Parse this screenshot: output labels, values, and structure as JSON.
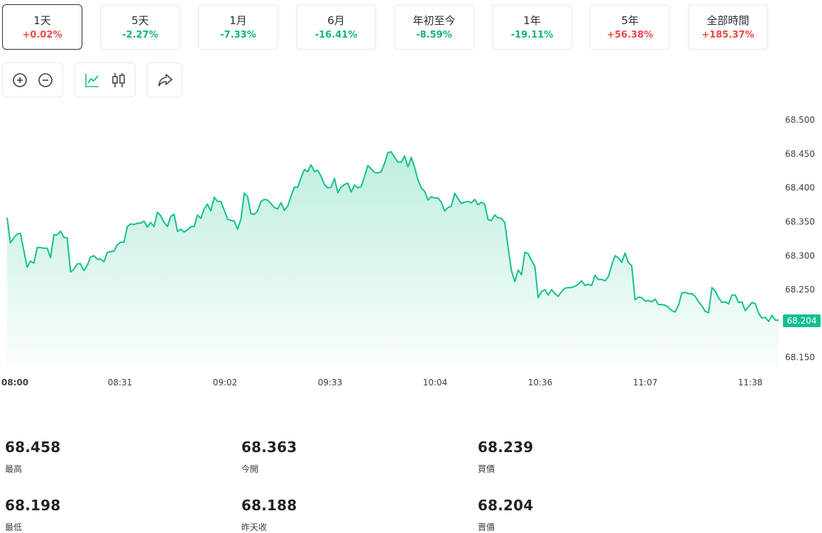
{
  "ranges": [
    {
      "label": "1天",
      "change": "+0.02%",
      "direction": "up",
      "active": true
    },
    {
      "label": "5天",
      "change": "-2.27%",
      "direction": "down",
      "active": false
    },
    {
      "label": "1月",
      "change": "-7.33%",
      "direction": "down",
      "active": false
    },
    {
      "label": "6月",
      "change": "-16.41%",
      "direction": "down",
      "active": false
    },
    {
      "label": "年初至今",
      "change": "-8.59%",
      "direction": "down",
      "active": false
    },
    {
      "label": "1年",
      "change": "-19.11%",
      "direction": "down",
      "active": false
    },
    {
      "label": "5年",
      "change": "+56.38%",
      "direction": "up",
      "active": false
    },
    {
      "label": "全部時間",
      "change": "+185.37%",
      "direction": "up",
      "active": false
    }
  ],
  "toolbar": {
    "zoom_in_icon": "zoom-in-icon",
    "zoom_out_icon": "zoom-out-icon",
    "line_chart_icon": "line-chart-icon",
    "candlestick_icon": "candlestick-icon",
    "share_icon": "share-icon",
    "active_chart_type": "line"
  },
  "colors": {
    "line": "#14c08f",
    "up": "#f04848",
    "down": "#14b37d",
    "price_tag": "#14c08f"
  },
  "chart_data": {
    "type": "area",
    "title": "",
    "xlabel": "",
    "ylabel": "",
    "ylim": [
      68.135,
      68.52
    ],
    "y_ticks": [
      "68.150",
      "68.200",
      "68.250",
      "68.300",
      "68.350",
      "68.400",
      "68.450",
      "68.500"
    ],
    "x_ticks": [
      "08:00",
      "08:31",
      "09:02",
      "09:33",
      "10:04",
      "10:36",
      "11:07",
      "11:38"
    ],
    "current_price": "68.204",
    "grid": false,
    "legend": "none",
    "series": [
      {
        "values": [
          68.356,
          68.319,
          68.326,
          68.332,
          68.333,
          68.308,
          68.283,
          68.292,
          68.289,
          68.312,
          68.312,
          68.311,
          68.311,
          68.297,
          68.331,
          68.331,
          68.336,
          68.327,
          68.326,
          68.276,
          68.28,
          68.288,
          68.288,
          68.278,
          68.286,
          68.298,
          68.3,
          68.295,
          68.295,
          68.291,
          68.305,
          68.306,
          68.307,
          68.316,
          68.32,
          68.32,
          68.343,
          68.347,
          68.346,
          68.348,
          68.348,
          68.351,
          68.342,
          68.349,
          68.343,
          68.364,
          68.359,
          68.349,
          68.343,
          68.358,
          68.361,
          68.336,
          68.339,
          68.335,
          68.338,
          68.343,
          68.343,
          68.36,
          68.355,
          68.369,
          68.376,
          68.366,
          68.386,
          68.38,
          68.38,
          68.367,
          68.354,
          68.352,
          68.351,
          68.339,
          68.354,
          68.392,
          68.387,
          68.362,
          68.361,
          68.366,
          68.38,
          68.383,
          68.382,
          68.377,
          68.371,
          68.369,
          68.378,
          68.367,
          68.373,
          68.388,
          68.401,
          68.401,
          68.415,
          68.427,
          68.424,
          68.434,
          68.424,
          68.426,
          68.417,
          68.405,
          68.4,
          68.401,
          68.414,
          68.393,
          68.401,
          68.405,
          68.407,
          68.394,
          68.404,
          68.4,
          68.402,
          68.417,
          68.433,
          68.428,
          68.423,
          68.422,
          68.424,
          68.436,
          68.452,
          68.453,
          68.445,
          68.438,
          68.438,
          68.447,
          68.431,
          68.445,
          68.43,
          68.412,
          68.4,
          68.395,
          68.382,
          68.387,
          68.385,
          68.385,
          68.379,
          68.366,
          68.371,
          68.373,
          68.392,
          68.384,
          68.377,
          68.379,
          68.38,
          68.378,
          68.383,
          68.375,
          68.379,
          68.376,
          68.353,
          68.352,
          68.36,
          68.356,
          68.355,
          68.349,
          68.312,
          68.278,
          68.262,
          68.279,
          68.272,
          68.305,
          68.303,
          68.293,
          68.284,
          68.238,
          68.247,
          68.25,
          68.242,
          68.25,
          68.244,
          68.24,
          68.247,
          68.252,
          68.253,
          68.253,
          68.255,
          68.258,
          68.263,
          68.256,
          68.258,
          68.256,
          68.271,
          68.265,
          68.265,
          68.263,
          68.269,
          68.286,
          68.3,
          68.297,
          68.29,
          68.304,
          68.29,
          68.285,
          68.235,
          68.239,
          68.238,
          68.233,
          68.234,
          68.232,
          68.236,
          68.228,
          68.228,
          68.227,
          68.224,
          68.219,
          68.217,
          68.227,
          68.245,
          68.246,
          68.244,
          68.244,
          68.24,
          68.232,
          68.226,
          68.218,
          68.216,
          68.253,
          68.248,
          68.238,
          68.231,
          68.232,
          68.229,
          68.242,
          68.242,
          68.231,
          68.232,
          68.219,
          68.225,
          68.231,
          68.229,
          68.215,
          68.208,
          68.209,
          68.203,
          68.212,
          68.205,
          68.205
        ]
      }
    ]
  },
  "stats": [
    {
      "value": "68.458",
      "label": "最高"
    },
    {
      "value": "68.363",
      "label": "今開"
    },
    {
      "value": "68.239",
      "label": "買價"
    },
    {
      "value": "68.198",
      "label": "最低"
    },
    {
      "value": "68.188",
      "label": "昨天收"
    },
    {
      "value": "68.204",
      "label": "賣價"
    }
  ]
}
